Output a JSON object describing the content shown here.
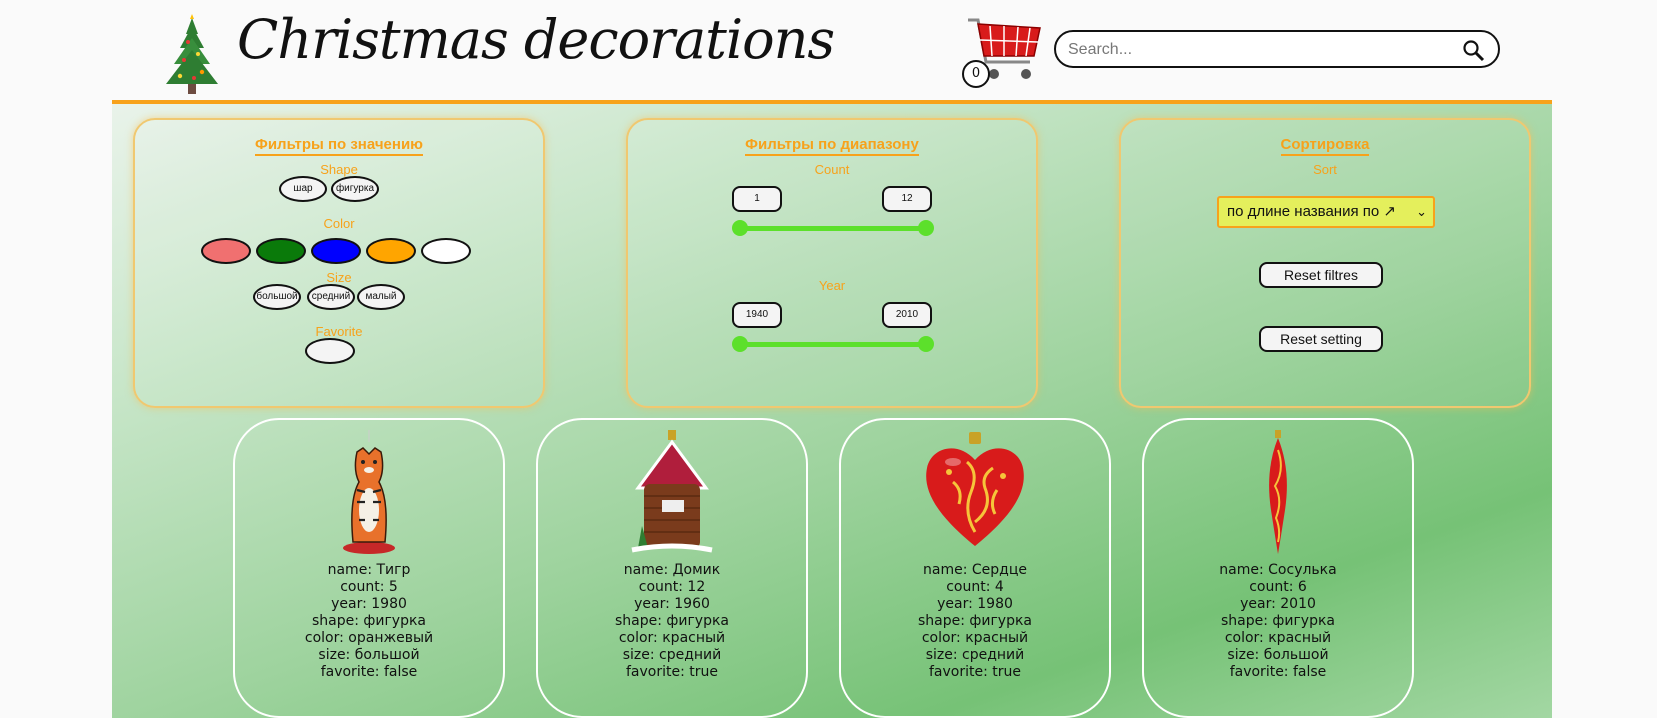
{
  "header": {
    "title": "Christmas decorations",
    "cart_count": "0",
    "search_placeholder": "Search..."
  },
  "filters_value": {
    "title": "Фильтры по значению",
    "shape_label": "Shape",
    "shapes": [
      "шар",
      "фигурка"
    ],
    "color_label": "Color",
    "colors": [
      "#f07070",
      "#0a7a0a",
      "#0000ff",
      "#ffa500",
      "#ffffff"
    ],
    "size_label": "Size",
    "sizes": [
      "большой",
      "средний",
      "малый"
    ],
    "favorite_label": "Favorite"
  },
  "filters_range": {
    "title": "Фильтры по диапазону",
    "count_label": "Count",
    "count_min": "1",
    "count_max": "12",
    "year_label": "Year",
    "year_min": "1940",
    "year_max": "2010"
  },
  "sorting": {
    "title": "Сортировка",
    "sort_label": "Sort",
    "selected": "по длине названия по ↗",
    "reset_filters": "Reset filtres",
    "reset_setting": "Reset setting"
  },
  "cards": [
    {
      "name": "name: Тигр",
      "count": "count: 5",
      "year": "year: 1980",
      "shape": "shape: фигурка",
      "color": "color: оранжевый",
      "size": "size: большой",
      "favorite": "favorite: false"
    },
    {
      "name": "name: Домик",
      "count": "count: 12",
      "year": "year: 1960",
      "shape": "shape: фигурка",
      "color": "color: красный",
      "size": "size: средний",
      "favorite": "favorite: true"
    },
    {
      "name": "name: Сердце",
      "count": "count: 4",
      "year": "year: 1980",
      "shape": "shape: фигурка",
      "color": "color: красный",
      "size": "size: средний",
      "favorite": "favorite: true"
    },
    {
      "name": "name: Сосулька",
      "count": "count: 6",
      "year": "year: 2010",
      "shape": "shape: фигурка",
      "color": "color: красный",
      "size": "size: большой",
      "favorite": "favorite: false"
    }
  ]
}
